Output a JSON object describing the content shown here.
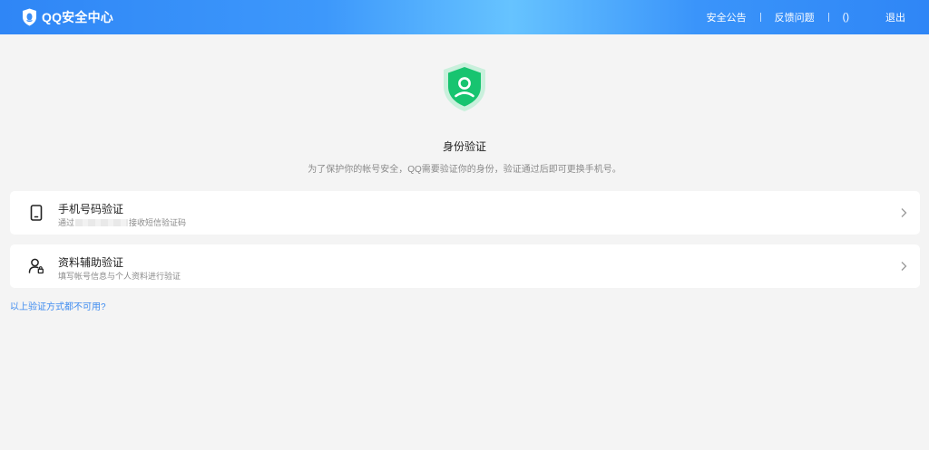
{
  "header": {
    "brand": "QQ安全中心",
    "nav": [
      "安全公告",
      "反馈问题",
      "()",
      "退出"
    ],
    "gradient_colors": [
      "#2f86f6",
      "#66c3ff"
    ]
  },
  "hero": {
    "icon": "shield-user-icon",
    "title": "身份验证",
    "description": "为了保护你的帐号安全，QQ需要验证你的身份，验证通过后即可更换手机号。"
  },
  "methods": [
    {
      "icon": "phone-icon",
      "title": "手机号码验证",
      "subtitle_prefix": "通过",
      "subtitle_suffix": "接收短信验证码"
    },
    {
      "icon": "user-profile-icon",
      "title": "资料辅助验证",
      "subtitle": "填写帐号信息与个人资料进行验证"
    }
  ],
  "fallback_link": "以上验证方式都不可用?",
  "colors": {
    "accent": "#3e8bf0",
    "shield_green": "#17c470"
  }
}
